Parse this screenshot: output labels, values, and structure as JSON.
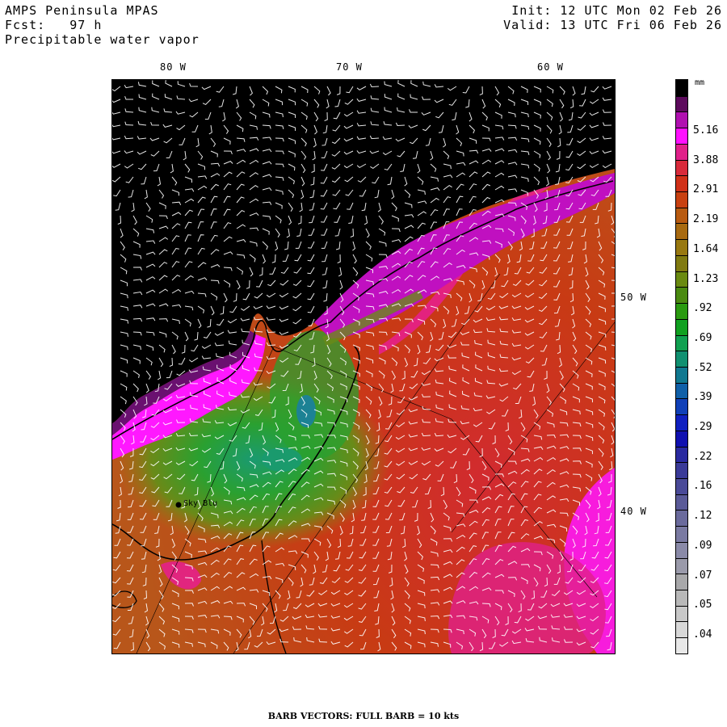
{
  "header": {
    "left_line1": "AMPS Peninsula MPAS",
    "left_line2": "Fcst:   97 h",
    "left_line3": "Precipitable water vapor",
    "right_line1": "Init: 12 UTC Mon 02 Feb 26",
    "right_line2": "Valid: 13 UTC Fri 06 Feb 26"
  },
  "map": {
    "longitude_labels": [
      "80 W",
      "70 W",
      "60 W"
    ],
    "latitude_labels": [
      "50 W",
      "40 W"
    ],
    "station_label": "Sky Blu"
  },
  "colorbar": {
    "unit": "mm",
    "labels": [
      "5.16",
      "3.88",
      "2.91",
      "2.19",
      "1.64",
      "1.23",
      ".92",
      ".69",
      ".52",
      ".39",
      ".29",
      ".22",
      ".16",
      ".12",
      ".09",
      ".07",
      ".05",
      ".04"
    ],
    "colors": [
      "#000000",
      "#5c0a5c",
      "#b010b0",
      "#ff10ff",
      "#e0208a",
      "#d82a3a",
      "#d03018",
      "#c84010",
      "#b85a10",
      "#a86a10",
      "#987810",
      "#807a10",
      "#6a8a10",
      "#4a8a10",
      "#2a9a10",
      "#10a020",
      "#10a050",
      "#109070",
      "#107890",
      "#1060a8",
      "#1040b8",
      "#1020c0",
      "#1010b0",
      "#2a2aa0",
      "#3a3a98",
      "#4a4a98",
      "#5a5a98",
      "#6a6a9c",
      "#7a7aa2",
      "#8a8aa8",
      "#9a9aaa",
      "#a8a8aa",
      "#b8b8b8",
      "#c8c8c8",
      "#d8d8d8",
      "#e8e8e8"
    ]
  },
  "footer": "BARB VECTORS:  FULL BARB = 10 kts"
}
